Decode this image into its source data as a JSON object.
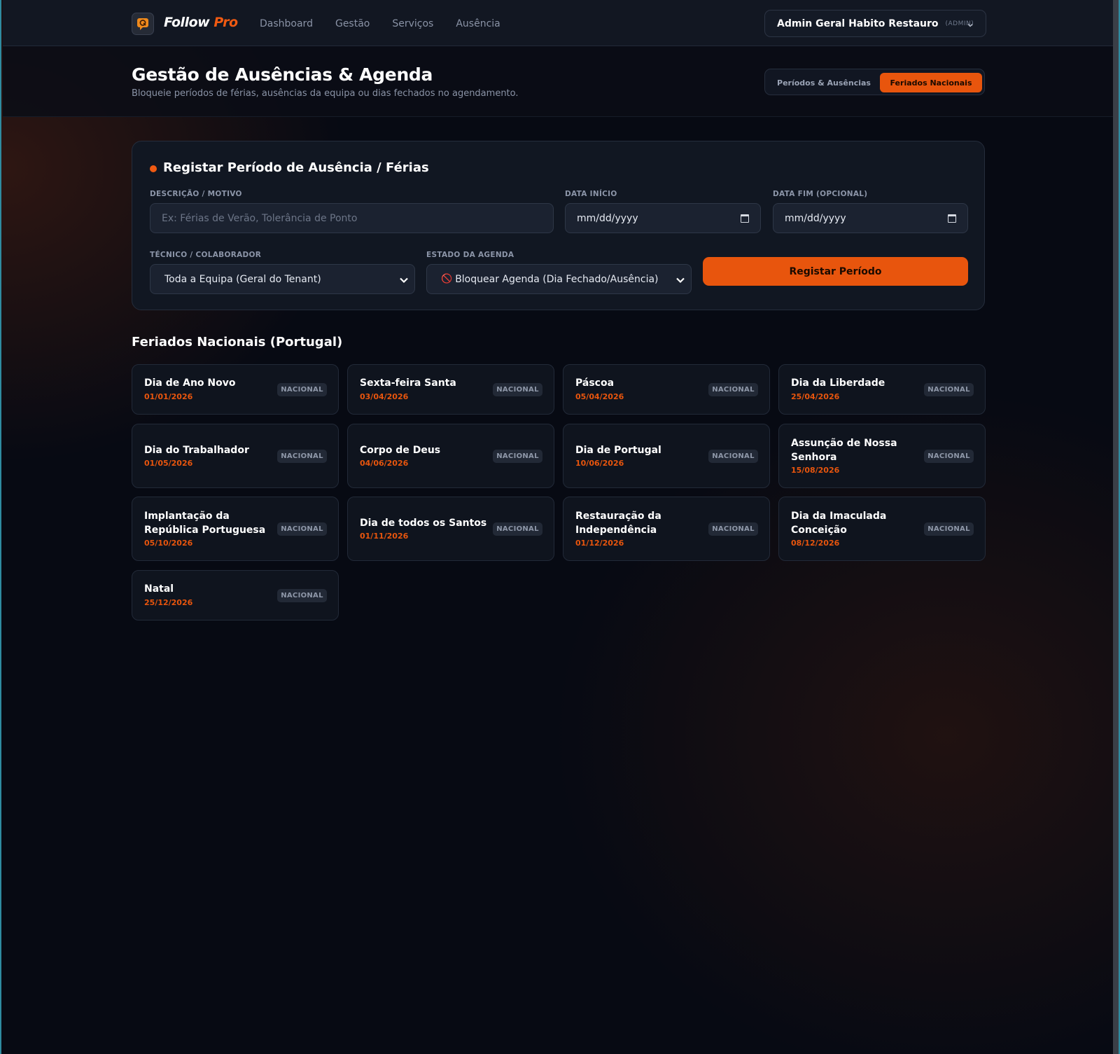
{
  "brand": {
    "name_primary": "Follow",
    "name_accent": "Pro"
  },
  "nav": {
    "items": [
      "Dashboard",
      "Gestão",
      "Serviços",
      "Ausência"
    ]
  },
  "user": {
    "name": "Admin Geral Habito Restauro",
    "role": "(ADMIN)"
  },
  "header": {
    "title": "Gestão de Ausências & Agenda",
    "subtitle": "Bloqueie períodos de férias, ausências da equipa ou dias fechados no agendamento.",
    "tabs": [
      {
        "label": "Períodos & Ausências",
        "active": false
      },
      {
        "label": "Feriados Nacionais",
        "active": true
      }
    ]
  },
  "form": {
    "title": "Registar Período de Ausência / Férias",
    "description": {
      "label": "DESCRIÇÃO / MOTIVO",
      "placeholder": "Ex: Férias de Verão, Tolerância de Ponto",
      "value": ""
    },
    "start_date": {
      "label": "DATA INÍCIO",
      "value": "mm/dd/yyyy"
    },
    "end_date": {
      "label": "DATA FIM (OPCIONAL)",
      "value": "mm/dd/yyyy"
    },
    "technician": {
      "label": "TÉCNICO / COLABORADOR",
      "value": "Toda a Equipa (Geral do Tenant)"
    },
    "agenda_state": {
      "label": "ESTADO DA AGENDA",
      "icon": "🚫",
      "value": "Bloquear Agenda (Dia Fechado/Ausência)"
    },
    "submit_label": "Registar Período"
  },
  "holidays": {
    "title": "Feriados Nacionais (Portugal)",
    "items": [
      {
        "name": "Dia de Ano Novo",
        "date": "01/01/2026",
        "badge": "NACIONAL"
      },
      {
        "name": "Sexta-feira Santa",
        "date": "03/04/2026",
        "badge": "NACIONAL"
      },
      {
        "name": "Páscoa",
        "date": "05/04/2026",
        "badge": "NACIONAL"
      },
      {
        "name": "Dia da Liberdade",
        "date": "25/04/2026",
        "badge": "NACIONAL"
      },
      {
        "name": "Dia do Trabalhador",
        "date": "01/05/2026",
        "badge": "NACIONAL"
      },
      {
        "name": "Corpo de Deus",
        "date": "04/06/2026",
        "badge": "NACIONAL"
      },
      {
        "name": "Dia de Portugal",
        "date": "10/06/2026",
        "badge": "NACIONAL"
      },
      {
        "name": "Assunção de Nossa Senhora",
        "date": "15/08/2026",
        "badge": "NACIONAL"
      },
      {
        "name": "Implantação da República Portuguesa",
        "date": "05/10/2026",
        "badge": "NACIONAL"
      },
      {
        "name": "Dia de todos os Santos",
        "date": "01/11/2026",
        "badge": "NACIONAL"
      },
      {
        "name": "Restauração da Independência",
        "date": "01/12/2026",
        "badge": "NACIONAL"
      },
      {
        "name": "Dia da Imaculada Conceição",
        "date": "08/12/2026",
        "badge": "NACIONAL"
      },
      {
        "name": "Natal",
        "date": "25/12/2026",
        "badge": "NACIONAL"
      }
    ]
  },
  "colors": {
    "accent": "#e8550d",
    "background": "#070a13",
    "card": "#111722"
  }
}
